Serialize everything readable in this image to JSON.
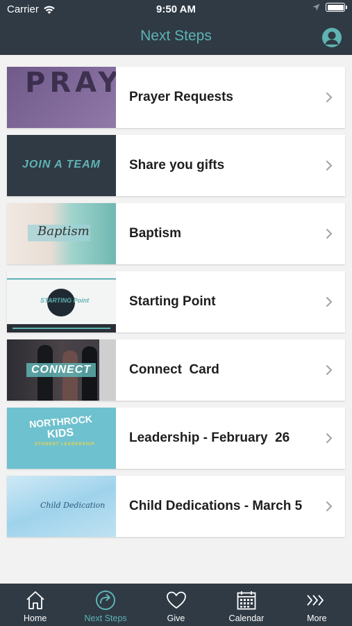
{
  "status_bar": {
    "carrier": "Carrier",
    "time": "9:50 AM"
  },
  "header": {
    "title": "Next Steps"
  },
  "colors": {
    "accent": "#5fb3b3",
    "bar_background": "#2f3a45",
    "page_background": "#f2f2f2"
  },
  "items": [
    {
      "label": "Prayer Requests",
      "thumb_text": "PRAYER",
      "thumb_icon": "prayer-thumbnail"
    },
    {
      "label": "Share you gifts",
      "thumb_text": "JOIN A TEAM",
      "thumb_icon": "join-a-team-thumbnail"
    },
    {
      "label": "Baptism",
      "thumb_text": "Baptism",
      "thumb_icon": "baptism-thumbnail"
    },
    {
      "label": "Starting Point",
      "thumb_text": "STARTING Point",
      "thumb_icon": "starting-point-thumbnail"
    },
    {
      "label": "Connect  Card",
      "thumb_text": "CONNECT",
      "thumb_icon": "connect-thumbnail"
    },
    {
      "label": "Leadership - February  26",
      "thumb_text_1": "NORTHROCK",
      "thumb_text_2": "KIDS",
      "thumb_text_3": "STUDENT LEADERSHIP",
      "thumb_icon": "northrock-kids-thumbnail"
    },
    {
      "label": "Child Dedications - March 5",
      "thumb_text": "Child Dedication",
      "thumb_icon": "child-dedication-thumbnail"
    }
  ],
  "tabs": [
    {
      "label": "Home",
      "icon": "home-icon",
      "active": false
    },
    {
      "label": "Next Steps",
      "icon": "next-steps-icon",
      "active": true
    },
    {
      "label": "Give",
      "icon": "heart-icon",
      "active": false
    },
    {
      "label": "Calendar",
      "icon": "calendar-icon",
      "active": false
    },
    {
      "label": "More",
      "icon": "more-chevrons-icon",
      "active": false
    }
  ]
}
